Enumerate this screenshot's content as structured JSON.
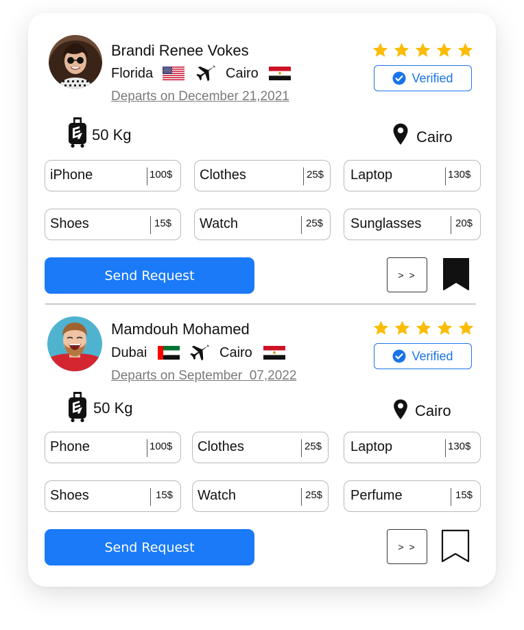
{
  "colors": {
    "accent": "#1a7af8",
    "star": "#fbbc04",
    "verified": "#1a73e8"
  },
  "trips": [
    {
      "traveler_name": "Brandi Renee Vokes",
      "from_city": "Florida",
      "from_flag": "usa-flag-icon",
      "to_city": "Cairo",
      "to_flag": "egypt-flag-icon",
      "departs": "Departs on December 21,2021",
      "rating": 5,
      "verified_label": "Verified",
      "weight": "50 Kg",
      "location": "Cairo",
      "items": [
        {
          "name": "iPhone",
          "price": "100$"
        },
        {
          "name": "Clothes",
          "price": "25$"
        },
        {
          "name": "Laptop",
          "price": "130$"
        },
        {
          "name": "Shoes",
          "price": "15$"
        },
        {
          "name": "Watch",
          "price": "25$"
        },
        {
          "name": "Sunglasses",
          "price": "20$"
        }
      ],
      "send_label": "Send Request",
      "more_label": "> >",
      "bookmarked": true
    },
    {
      "traveler_name": "Mamdouh Mohamed",
      "from_city": "Dubai",
      "from_flag": "uae-flag-icon",
      "to_city": "Cairo",
      "to_flag": "egypt-flag-icon",
      "departs": "Departs on September  07,2022",
      "rating": 5,
      "verified_label": "Verified",
      "weight": "50 Kg",
      "location": "Cairo",
      "items": [
        {
          "name": "Phone",
          "price": "100$"
        },
        {
          "name": "Clothes",
          "price": "25$"
        },
        {
          "name": "Laptop",
          "price": "130$"
        },
        {
          "name": "Shoes",
          "price": "15$"
        },
        {
          "name": "Watch",
          "price": "25$"
        },
        {
          "name": "Perfume",
          "price": "15$"
        }
      ],
      "send_label": "Send Request",
      "more_label": "> >",
      "bookmarked": false
    }
  ]
}
